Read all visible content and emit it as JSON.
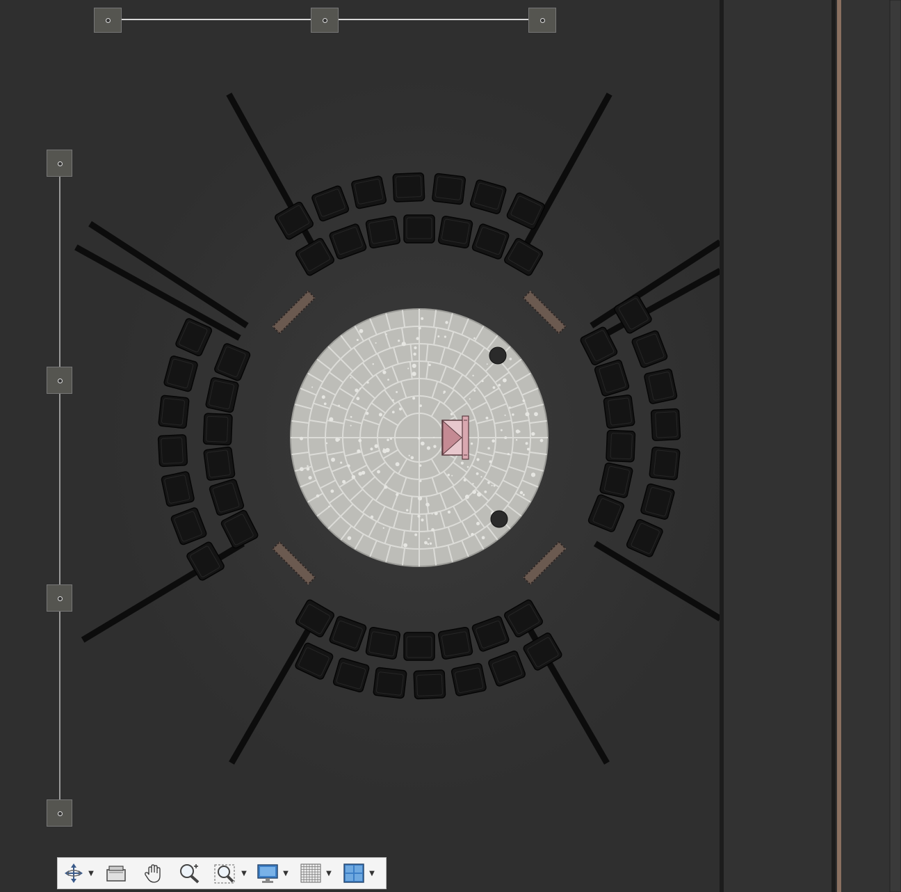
{
  "canvas": {
    "background": "#2f2f2f",
    "panel_right_background": "#333333",
    "accent_line_color": "#8a7060"
  },
  "scene": {
    "floor_color": "#bdbdb8",
    "seat_color": "#141414",
    "pillar_color": "#6b5a50",
    "selected_object_color": "#d9a8b0"
  },
  "toolbar": {
    "tools": [
      {
        "name": "orbit",
        "icon": "orbit-icon",
        "has_dropdown": true
      },
      {
        "name": "camera",
        "icon": "camera-icon",
        "has_dropdown": false
      },
      {
        "name": "pan",
        "icon": "hand-icon",
        "has_dropdown": false
      },
      {
        "name": "zoom",
        "icon": "zoom-in-icon",
        "has_dropdown": false
      },
      {
        "name": "zoom-window",
        "icon": "zoom-window-icon",
        "has_dropdown": true
      },
      {
        "name": "display",
        "icon": "monitor-icon",
        "has_dropdown": true
      },
      {
        "name": "grid",
        "icon": "grid-icon",
        "has_dropdown": true
      },
      {
        "name": "viewports",
        "icon": "viewports-icon",
        "has_dropdown": true
      }
    ]
  }
}
